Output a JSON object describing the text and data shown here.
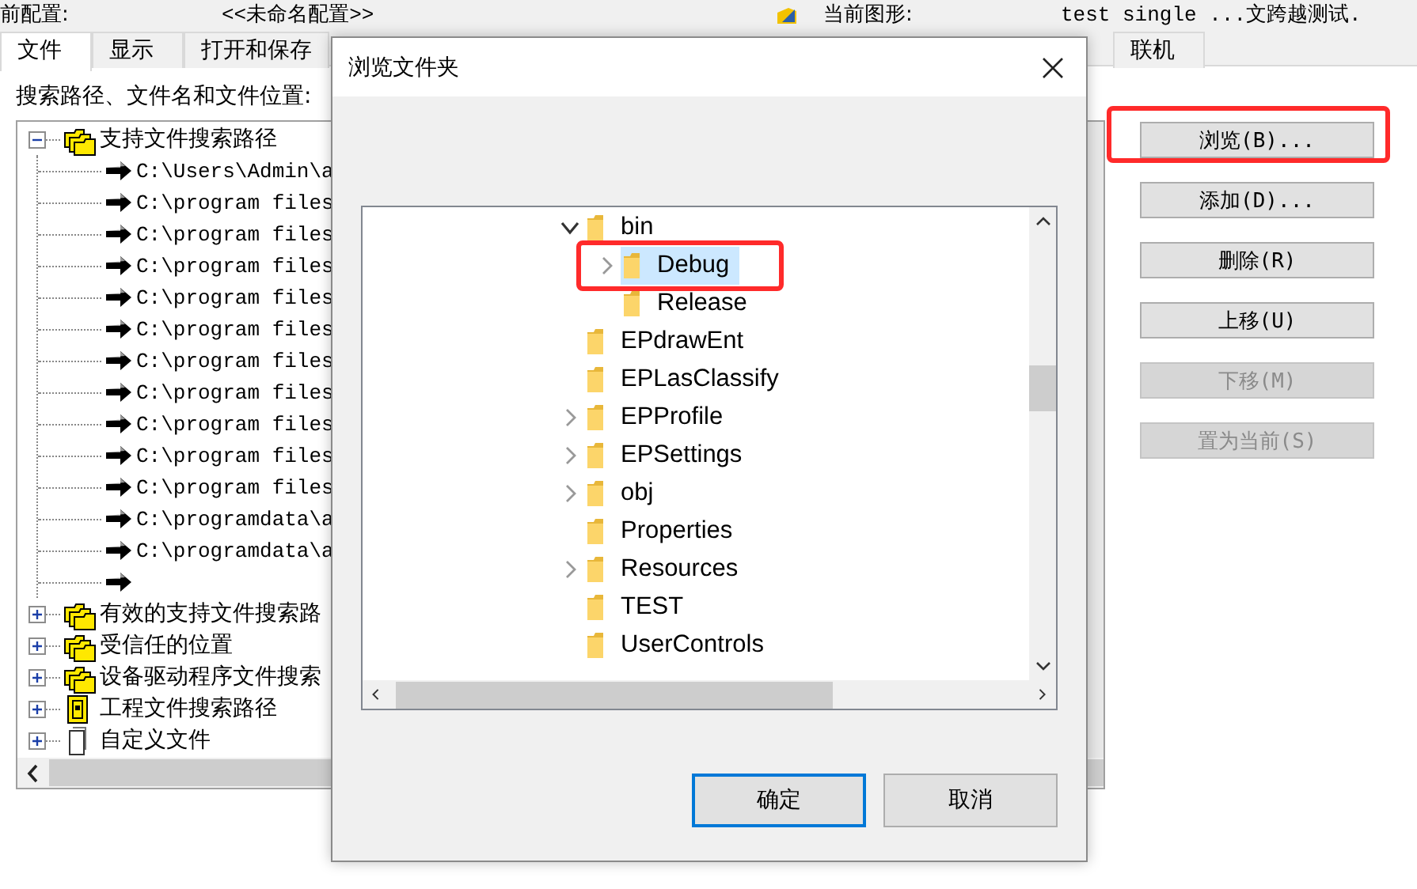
{
  "header": {
    "config_label": "前配置:",
    "config_value": "<<未命名配置>>",
    "drawing_label": "当前图形:",
    "drawing_value": "test single ...文跨越测试."
  },
  "tabs": [
    {
      "label": "文件",
      "selected": true
    },
    {
      "label": "显示",
      "selected": false
    },
    {
      "label": "打开和保存",
      "selected": false
    },
    {
      "label": "联机",
      "selected": false
    }
  ],
  "section_label": "搜索路径、文件名和文件位置:",
  "tree": [
    {
      "label": "支持文件搜索路径",
      "kind": "folders",
      "expanded": true,
      "children": [
        {
          "label": "C:\\Users\\Admin\\a",
          "kind": "path"
        },
        {
          "label": "C:\\program files",
          "kind": "path"
        },
        {
          "label": "C:\\program files",
          "kind": "path"
        },
        {
          "label": "C:\\program files",
          "kind": "path"
        },
        {
          "label": "C:\\program files",
          "kind": "path"
        },
        {
          "label": "C:\\program files",
          "kind": "path"
        },
        {
          "label": "C:\\program files",
          "kind": "path"
        },
        {
          "label": "C:\\program files",
          "kind": "path"
        },
        {
          "label": "C:\\program files",
          "kind": "path"
        },
        {
          "label": "C:\\program files",
          "kind": "path"
        },
        {
          "label": "C:\\program files",
          "kind": "path"
        },
        {
          "label": "C:\\programdata\\a",
          "kind": "path"
        },
        {
          "label": "C:\\programdata\\a",
          "kind": "path"
        },
        {
          "kind": "path"
        }
      ]
    },
    {
      "label": "有效的支持文件搜索路",
      "kind": "folders",
      "expanded": false
    },
    {
      "label": "受信任的位置",
      "kind": "folders",
      "expanded": false
    },
    {
      "label": "设备驱动程序文件搜索",
      "kind": "folders",
      "expanded": false
    },
    {
      "label": "工程文件搜索路径",
      "kind": "project",
      "expanded": false
    },
    {
      "label": "自定义文件",
      "kind": "file",
      "expanded": false
    }
  ],
  "buttons": [
    {
      "label": "浏览(B)...",
      "disabled": false,
      "highlighted": true
    },
    {
      "label": "添加(D)...",
      "disabled": false,
      "highlighted": false
    },
    {
      "label": "删除(R)",
      "disabled": false,
      "highlighted": false
    },
    {
      "label": "上移(U)",
      "disabled": false,
      "highlighted": false
    },
    {
      "label": "下移(M)",
      "disabled": true,
      "highlighted": false
    },
    {
      "label": "置为当前(S)",
      "disabled": true,
      "highlighted": false
    }
  ],
  "dialog": {
    "title": "浏览文件夹",
    "folders": [
      {
        "label": "bin",
        "expandable": true,
        "expanded": true,
        "selected": false,
        "highlighted": false,
        "children": [
          {
            "label": "Debug",
            "expandable": true,
            "expanded": false,
            "selected": true,
            "highlighted": true
          },
          {
            "label": "Release",
            "expandable": false,
            "expanded": false,
            "selected": false,
            "highlighted": false
          }
        ]
      },
      {
        "label": "EPdrawEnt",
        "expandable": false,
        "expanded": false,
        "selected": false,
        "highlighted": false
      },
      {
        "label": "EPLasClassify",
        "expandable": false,
        "expanded": false,
        "selected": false,
        "highlighted": false
      },
      {
        "label": "EPProfile",
        "expandable": true,
        "expanded": false,
        "selected": false,
        "highlighted": false
      },
      {
        "label": "EPSettings",
        "expandable": true,
        "expanded": false,
        "selected": false,
        "highlighted": false
      },
      {
        "label": "obj",
        "expandable": true,
        "expanded": false,
        "selected": false,
        "highlighted": false
      },
      {
        "label": "Properties",
        "expandable": false,
        "expanded": false,
        "selected": false,
        "highlighted": false
      },
      {
        "label": "Resources",
        "expandable": true,
        "expanded": false,
        "selected": false,
        "highlighted": false
      },
      {
        "label": "TEST",
        "expandable": false,
        "expanded": false,
        "selected": false,
        "highlighted": false
      },
      {
        "label": "UserControls",
        "expandable": false,
        "expanded": false,
        "selected": false,
        "highlighted": false
      }
    ],
    "buttons": [
      {
        "label": "确定",
        "default": true
      },
      {
        "label": "取消",
        "default": false
      }
    ]
  }
}
